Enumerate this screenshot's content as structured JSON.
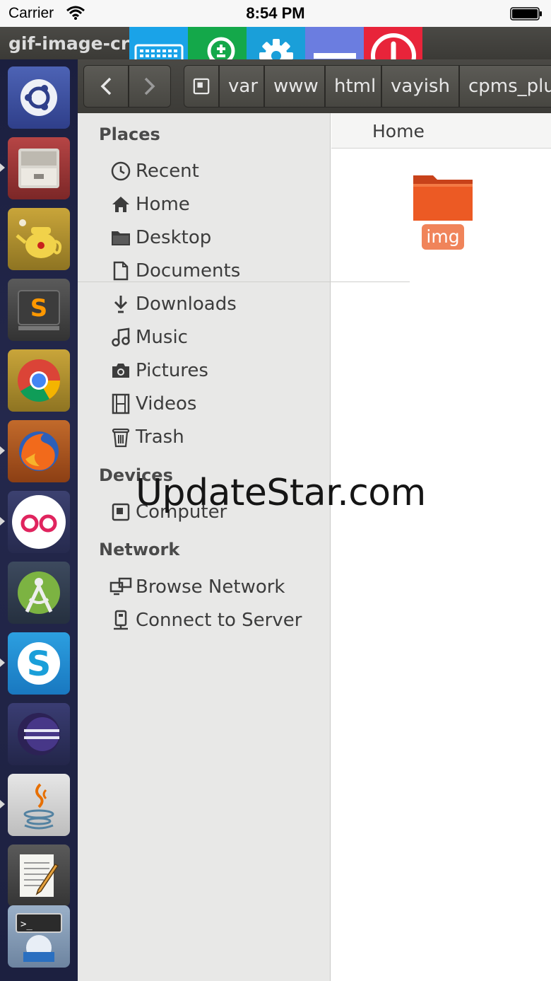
{
  "status_bar": {
    "carrier": "Carrier",
    "time": "8:54 PM"
  },
  "window": {
    "title": "gif-image-cre"
  },
  "remote_toolbar": {
    "buttons": [
      {
        "icon": "keyboard-icon",
        "color": "#1aa3e8"
      },
      {
        "icon": "zoom-icon",
        "color": "#14a84a"
      },
      {
        "icon": "gear-icon",
        "color": "#1a9fd9"
      },
      {
        "icon": "minimize-icon",
        "color": "#6b7de0"
      },
      {
        "icon": "power-icon",
        "color": "#e8243a"
      }
    ]
  },
  "launcher": {
    "items": [
      {
        "icon": "ubuntu-dash-icon"
      },
      {
        "icon": "file-cabinet-icon"
      },
      {
        "icon": "teapot-icon"
      },
      {
        "icon": "sublime-text-icon"
      },
      {
        "icon": "chrome-icon"
      },
      {
        "icon": "firefox-icon"
      },
      {
        "icon": "flickr-icon"
      },
      {
        "icon": "android-studio-icon"
      },
      {
        "icon": "skype-icon"
      },
      {
        "icon": "eclipse-icon"
      },
      {
        "icon": "java-icon"
      },
      {
        "icon": "text-editor-icon"
      },
      {
        "icon": "terminal-icon"
      }
    ]
  },
  "breadcrumbs": [
    "var",
    "www",
    "html",
    "vayish",
    "cpms_plu"
  ],
  "sidebar": {
    "places": {
      "heading": "Places",
      "items": [
        "Recent",
        "Home",
        "Desktop",
        "Documents",
        "Downloads",
        "Music",
        "Pictures",
        "Videos",
        "Trash"
      ]
    },
    "devices": {
      "heading": "Devices",
      "items": [
        "Computer"
      ]
    },
    "network": {
      "heading": "Network",
      "items": [
        "Browse Network",
        "Connect to Server"
      ]
    }
  },
  "content": {
    "tab": "Home",
    "folder": {
      "name": "img"
    }
  },
  "watermark": "UpdateStar.com"
}
